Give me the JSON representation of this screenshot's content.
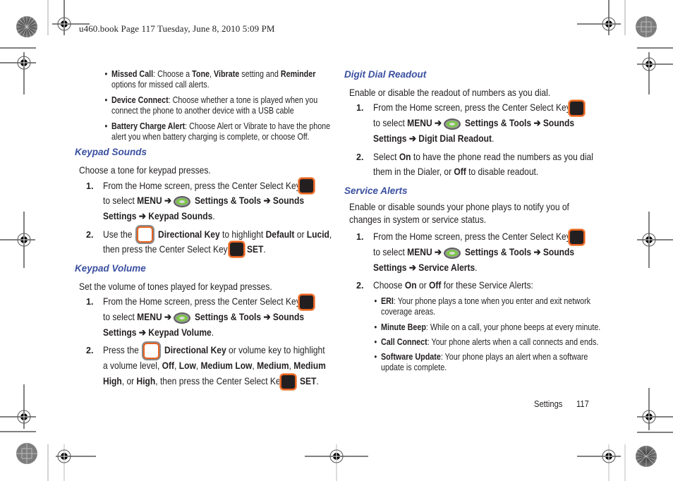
{
  "header": {
    "print_line": "u460.book  Page 117  Tuesday, June 8, 2010  5:09 PM"
  },
  "left": {
    "bullets": [
      {
        "parts": [
          [
            "b",
            "Missed Call"
          ],
          [
            "t",
            ": Choose a "
          ],
          [
            "b",
            "Tone"
          ],
          [
            "t",
            ", "
          ],
          [
            "b",
            "Vibrate"
          ],
          [
            "t",
            " setting and "
          ],
          [
            "b",
            "Reminder"
          ]
        ],
        "line2": "options for missed call alerts."
      },
      {
        "parts": [
          [
            "b",
            "Device Connect"
          ],
          [
            "t",
            ": Choose whether a tone is played when you"
          ]
        ],
        "line2": "connect the phone to another device with a USB cable"
      },
      {
        "parts": [
          [
            "b",
            "Battery Charge Alert"
          ],
          [
            "t",
            ": Choose Alert or Vibrate to have the phone"
          ]
        ],
        "line2": "alert you when battery charging is complete, or choose Off."
      }
    ],
    "keypad_sounds": {
      "heading": "Keypad Sounds",
      "intro": "Choose a tone for keypad presses.",
      "step1_num": "1.",
      "step1_line1": "From the Home screen, press the Center Select Key",
      "step1_line2_pre": "to select ",
      "menu": "MENU",
      "arrow": "➔",
      "settings_tools": "Settings & Tools",
      "sounds": "Sounds",
      "settings": "Settings",
      "step1_target": "Keypad Sounds",
      "step2_num": "2.",
      "step2_pre": "Use the",
      "directional_key": "Directional Key",
      "step2_mid": "to highlight",
      "opt_default": "Default",
      "or": "or",
      "opt_lucid": "Lucid",
      "step2_line2": "then press the Center Select Key",
      "set": "SET"
    },
    "keypad_volume": {
      "heading": "Keypad Volume",
      "intro": "Set the volume of tones played for keypad presses.",
      "step1_num": "1.",
      "step1_line1": "From the Home screen, press the Center Select Key",
      "step1_target": "Keypad Volume",
      "step2_num": "2.",
      "step2_pre": "Press the",
      "directional_key": "Directional Key",
      "step2_mid": "or volume key to highlight",
      "step2_line2_pre": "a volume level,",
      "levels": [
        "Off",
        "Low",
        "Medium Low",
        "Medium",
        "Medium High",
        "High"
      ],
      "step2_line3_post": ", then press the Center Select Key",
      "set": "SET"
    }
  },
  "right": {
    "digit_dial": {
      "heading": "Digit Dial Readout",
      "intro": "Enable or disable the readout of numbers as you dial.",
      "step1_num": "1.",
      "step1_line1": "From the Home screen, press the Center Select Key",
      "step1_target": "Digit Dial Readout",
      "step2_num": "2.",
      "step2_pre": "Select",
      "on": "On",
      "step2_mid": "to have the phone read the numbers as you dial",
      "step2_line2_pre": "them in the Dialer, or",
      "off": "Off",
      "step2_line2_post": "to disable readout."
    },
    "service_alerts": {
      "heading": "Service Alerts",
      "intro_line1": "Enable or disable sounds your phone plays to notify you of",
      "intro_line2": "changes in system or service status.",
      "step1_num": "1.",
      "step1_line1": "From the Home screen, press the Center Select Key",
      "step1_target": "Service Alerts",
      "step2_num": "2.",
      "step2_pre": "Choose",
      "on": "On",
      "off": "Off",
      "step2_post": "for these Service Alerts:",
      "alerts": [
        {
          "name": "ERI",
          "desc": ": Your phone plays a tone when you enter and exit network",
          "line2": "coverage areas."
        },
        {
          "name": "Minute Beep",
          "desc": ": While on a call, your phone beeps at every minute.",
          "line2": ""
        },
        {
          "name": "Call Connect",
          "desc": ": Your phone alerts when a call connects and ends.",
          "line2": ""
        },
        {
          "name": "Software Update",
          "desc": ": Your phone plays an alert when a software",
          "line2": "update is complete."
        }
      ]
    }
  },
  "footer": {
    "section": "Settings",
    "page": "117"
  },
  "colors": {
    "heading": "#3a4fa0",
    "key_border": "#e8621f",
    "key_fill": "#231f20",
    "gear_ring": "#7ac943"
  }
}
